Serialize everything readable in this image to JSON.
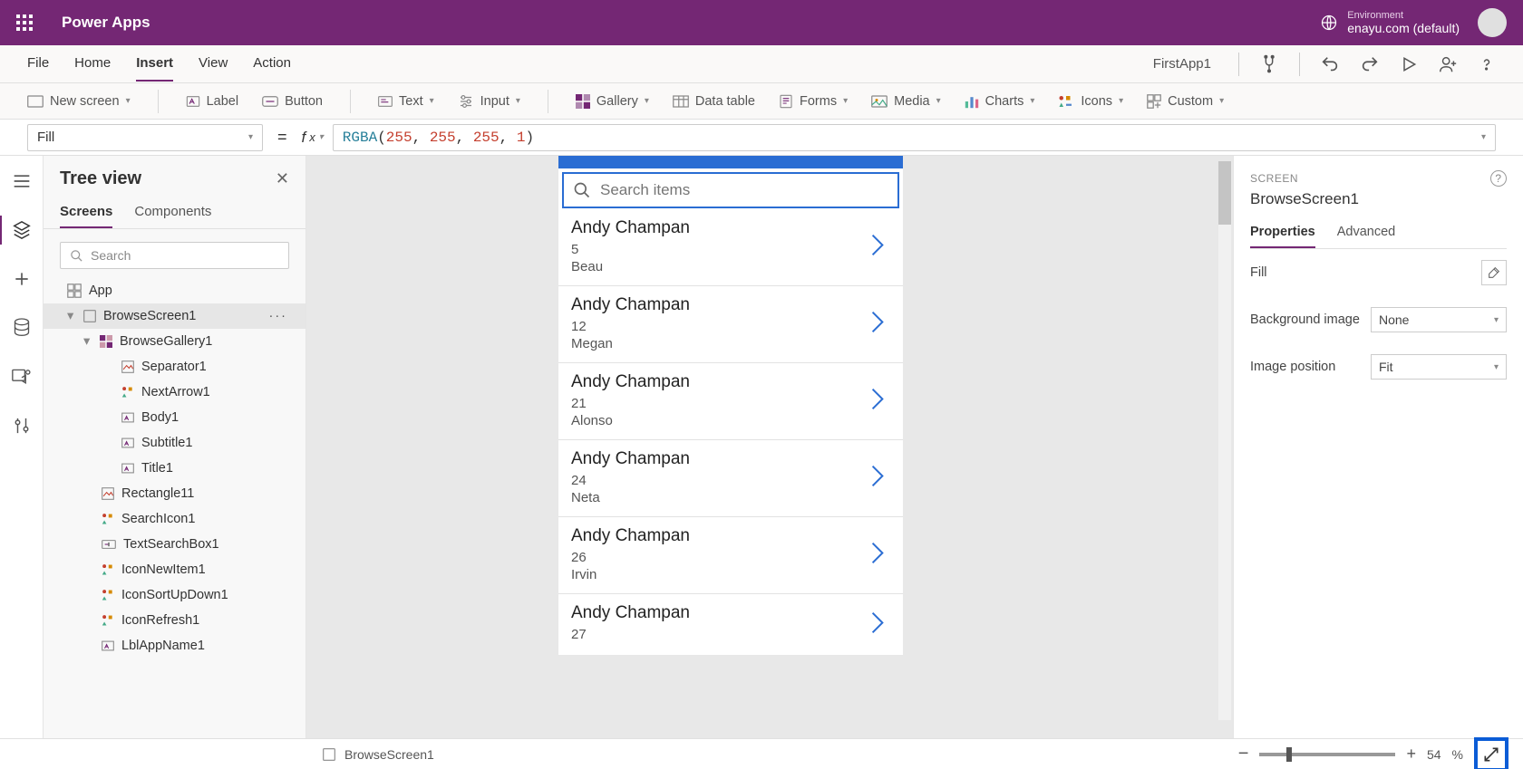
{
  "header": {
    "app_title": "Power Apps",
    "environment_label": "Environment",
    "environment_value": "enayu.com (default)"
  },
  "menubar": {
    "items": [
      "File",
      "Home",
      "Insert",
      "View",
      "Action"
    ],
    "active": "Insert",
    "app_name": "FirstApp1"
  },
  "toolbar": {
    "new_screen": "New screen",
    "label": "Label",
    "button": "Button",
    "text": "Text",
    "input": "Input",
    "gallery": "Gallery",
    "data_table": "Data table",
    "forms": "Forms",
    "media": "Media",
    "charts": "Charts",
    "icons": "Icons",
    "custom": "Custom"
  },
  "formula": {
    "property": "Fill",
    "func": "RGBA",
    "args": [
      "255",
      "255",
      "255",
      "1"
    ]
  },
  "tree": {
    "title": "Tree view",
    "tabs": {
      "screens": "Screens",
      "components": "Components"
    },
    "search_placeholder": "Search",
    "nodes": {
      "app": "App",
      "browse_screen": "BrowseScreen1",
      "browse_gallery": "BrowseGallery1",
      "separator": "Separator1",
      "next_arrow": "NextArrow1",
      "body": "Body1",
      "subtitle": "Subtitle1",
      "title": "Title1",
      "rectangle": "Rectangle11",
      "search_icon": "SearchIcon1",
      "text_search": "TextSearchBox1",
      "icon_new": "IconNewItem1",
      "icon_sort": "IconSortUpDown1",
      "icon_refresh": "IconRefresh1",
      "lbl_app": "LblAppName1"
    }
  },
  "canvas": {
    "search_placeholder": "Search items",
    "items": [
      {
        "title": "Andy Champan",
        "subtitle": "5",
        "body": "Beau"
      },
      {
        "title": "Andy Champan",
        "subtitle": "12",
        "body": "Megan"
      },
      {
        "title": "Andy Champan",
        "subtitle": "21",
        "body": "Alonso"
      },
      {
        "title": "Andy Champan",
        "subtitle": "24",
        "body": "Neta"
      },
      {
        "title": "Andy Champan",
        "subtitle": "26",
        "body": "Irvin"
      },
      {
        "title": "Andy Champan",
        "subtitle": "27",
        "body": ""
      }
    ]
  },
  "props": {
    "type_label": "SCREEN",
    "name": "BrowseScreen1",
    "tabs": {
      "properties": "Properties",
      "advanced": "Advanced"
    },
    "rows": {
      "fill": "Fill",
      "bg_image": "Background image",
      "bg_image_val": "None",
      "img_pos": "Image position",
      "img_pos_val": "Fit"
    }
  },
  "status": {
    "screen": "BrowseScreen1",
    "zoom": "54",
    "pct": "%"
  }
}
